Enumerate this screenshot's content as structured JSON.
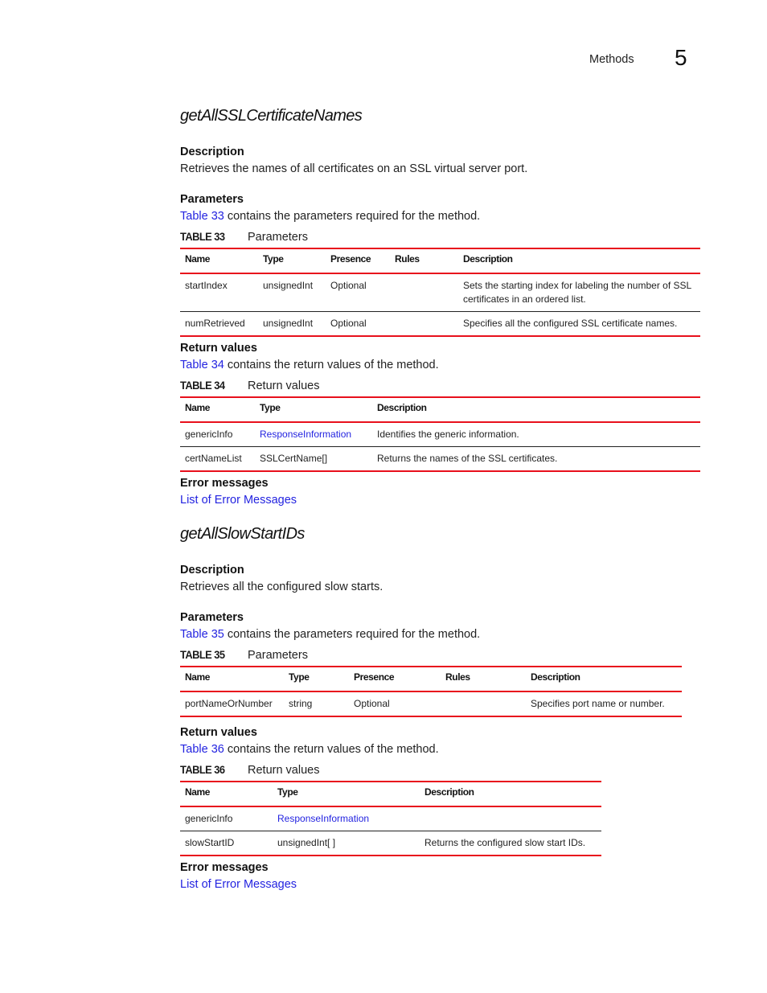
{
  "header": {
    "section": "Methods",
    "chapter": "5"
  },
  "methods": [
    {
      "title": "getAllSSLCertificateNames",
      "description_heading": "Description",
      "description": "Retrieves the names of all certificates on an SSL virtual server port.",
      "parameters_heading": "Parameters",
      "parameters_link": "Table 33",
      "parameters_text": " contains the parameters required for the method.",
      "parameters_table": {
        "number": "TABLE 33",
        "title": "Parameters",
        "columns": [
          "Name",
          "Type",
          "Presence",
          "Rules",
          "Description"
        ],
        "rows": [
          {
            "name": "startIndex",
            "type": "unsignedInt",
            "presence": "Optional",
            "rules": "",
            "description": "Sets the starting index for labeling the number of SSL certificates in an ordered list."
          },
          {
            "name": "numRetrieved",
            "type": "unsignedInt",
            "presence": "Optional",
            "rules": "",
            "description": "Specifies all the configured SSL certificate names."
          }
        ]
      },
      "returns_heading": "Return values",
      "returns_link": "Table 34",
      "returns_text": " contains the return values of the method.",
      "returns_table": {
        "number": "TABLE 34",
        "title": "Return values",
        "columns": [
          "Name",
          "Type",
          "Description"
        ],
        "rows": [
          {
            "name": "genericInfo",
            "type": "ResponseInformation",
            "type_is_link": true,
            "description": "Identifies the generic information."
          },
          {
            "name": "certNameList",
            "type": "SSLCertName[]",
            "type_is_link": false,
            "description": "Returns the names of the SSL certificates."
          }
        ]
      },
      "errors_heading": "Error messages",
      "errors_link": "List of Error Messages"
    },
    {
      "title": "getAllSlowStartIDs",
      "description_heading": "Description",
      "description": "Retrieves all the configured slow starts.",
      "parameters_heading": "Parameters",
      "parameters_link": "Table 35",
      "parameters_text": " contains the parameters required for the method.",
      "parameters_table": {
        "number": "TABLE 35",
        "title": "Parameters",
        "columns": [
          "Name",
          "Type",
          "Presence",
          "Rules",
          "Description"
        ],
        "rows": [
          {
            "name": "portNameOrNumber",
            "type": "string",
            "presence": "Optional",
            "rules": "",
            "description": "Specifies port name or number."
          }
        ]
      },
      "returns_heading": "Return values",
      "returns_link": "Table 36",
      "returns_text": " contains the return values of the method.",
      "returns_table": {
        "number": "TABLE 36",
        "title": "Return values",
        "columns": [
          "Name",
          "Type",
          "Description"
        ],
        "rows": [
          {
            "name": "genericInfo",
            "type": "ResponseInformation",
            "type_is_link": true,
            "description": ""
          },
          {
            "name": "slowStartID",
            "type": "unsignedInt[ ]",
            "type_is_link": false,
            "description": "Returns the configured slow start IDs."
          }
        ]
      },
      "errors_heading": "Error messages",
      "errors_link": "List of Error Messages"
    }
  ]
}
